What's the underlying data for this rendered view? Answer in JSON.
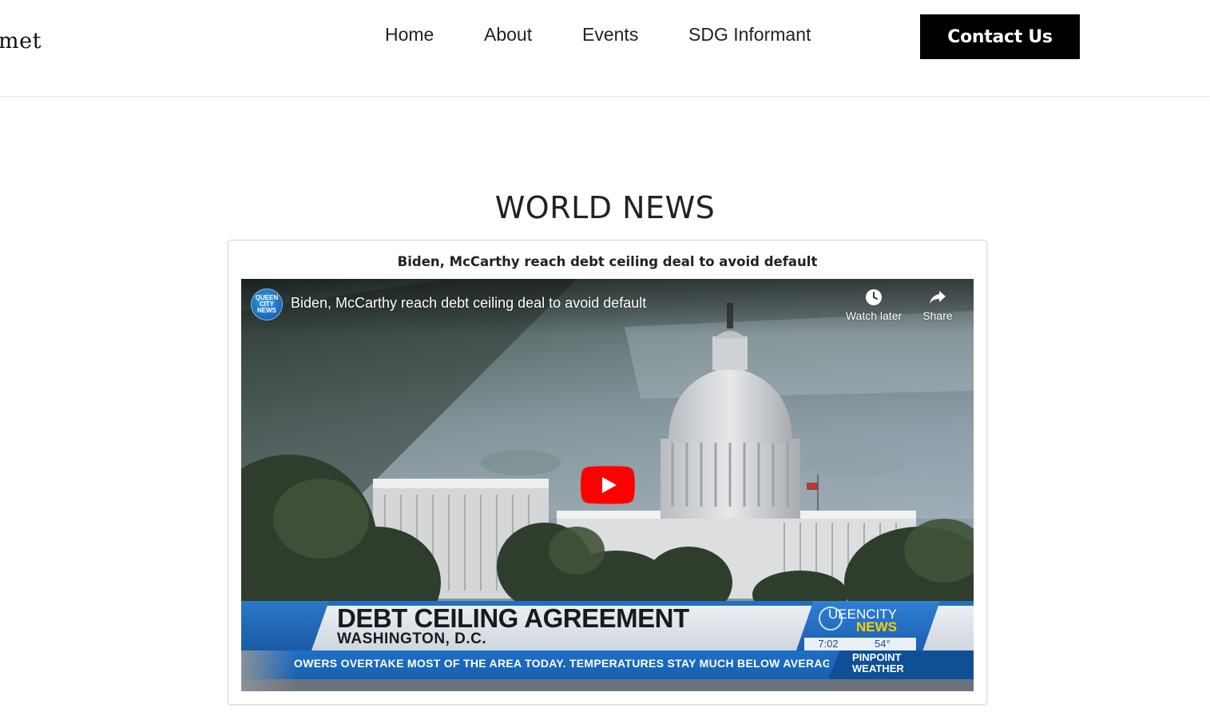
{
  "header": {
    "logo_text": "met",
    "nav": [
      {
        "label": "Home"
      },
      {
        "label": "About"
      },
      {
        "label": "Events"
      },
      {
        "label": "SDG Informant"
      }
    ],
    "contact_label": "Contact Us"
  },
  "section": {
    "title": "WORLD NEWS"
  },
  "article": {
    "title": "Biden, McCarthy reach debt ceiling deal to avoid default",
    "video": {
      "title": "Biden, McCarthy reach debt ceiling deal to avoid default",
      "channel_avatar_text": "QUEEN CITY NEWS",
      "watch_later_label": "Watch later",
      "share_label": "Share",
      "lower_third": {
        "headline": "DEBT CEILING AGREEMENT",
        "location": "WASHINGTON, D.C.",
        "brand_top": "UEENCITY",
        "brand_bottom": "NEWS",
        "time": "7:02",
        "temp": "54°",
        "ticker": "OWERS OVERTAKE MOST OF THE AREA TODAY. TEMPERATURES STAY MUCH BELOW AVERAGE W",
        "ticker_tag_line1": "PINPOINT",
        "ticker_tag_line2": "WEATHER"
      }
    }
  },
  "colors": {
    "contact_bg": "#000000",
    "youtube_red": "#ff0000",
    "news_blue": "#1e6fc8",
    "news_yellow": "#f5d000"
  },
  "icons": [
    "clock-icon",
    "share-icon",
    "play-icon",
    "channel-avatar"
  ]
}
